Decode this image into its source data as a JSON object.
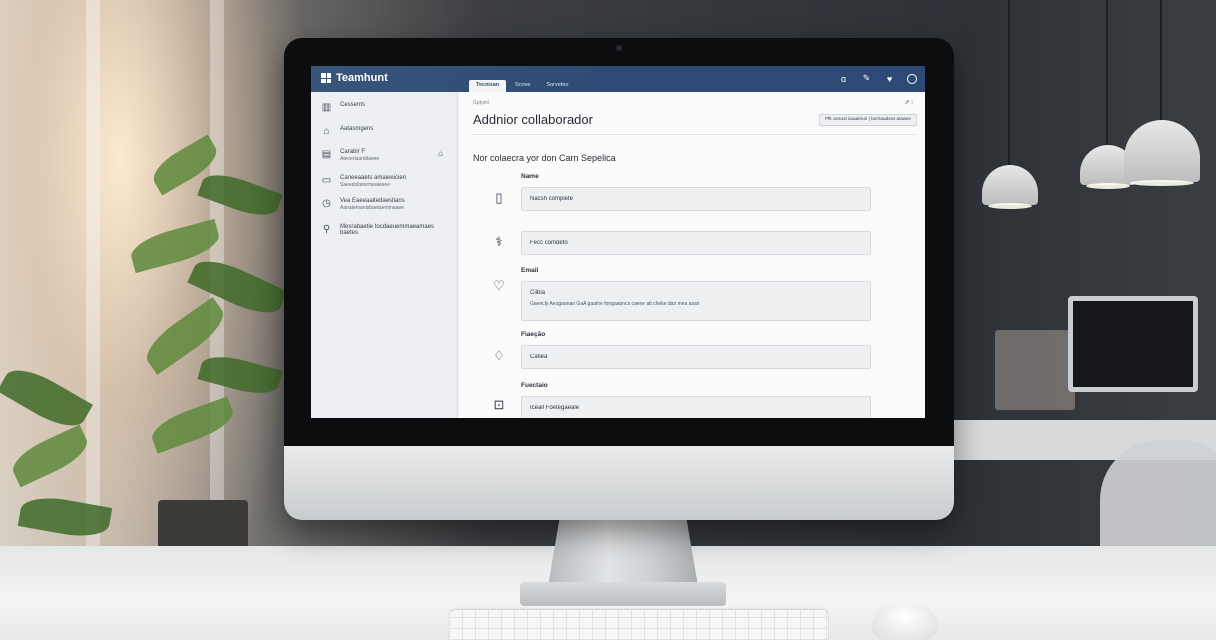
{
  "app": {
    "title": "Teamhunt",
    "tabs": [
      {
        "label": "Tecnizan",
        "active": true
      },
      {
        "label": "Scrive",
        "active": false
      },
      {
        "label": "Sorveteo",
        "active": false
      }
    ],
    "top_icons": [
      "info-icon",
      "pen-icon",
      "heart-icon",
      "circle-icon"
    ]
  },
  "sidebar": {
    "items": [
      {
        "icon": "chart-bar-icon",
        "label": "Cessents",
        "sub": ""
      },
      {
        "icon": "building-icon",
        "label": "Aatasmgens",
        "sub": ""
      },
      {
        "icon": "calendar-icon",
        "label": "Carabir F",
        "sub": "Ateceriaandtaeee",
        "extra": "⌂"
      },
      {
        "icon": "monitor-icon",
        "label": "Caneeaaets amaieeicien",
        "sub": "Saeedoltanemeaieeee"
      },
      {
        "icon": "clock-icon",
        "label": "Vea Eaeeaaitedaestians",
        "sub": "Aanatemanisbaetaemmaaee"
      },
      {
        "icon": "user-search-icon",
        "label": "Mesrabaetie tocdaeuemmaeamaes baetes",
        "sub": ""
      }
    ]
  },
  "main": {
    "breadcrumb": "Gptyeti",
    "title": "Addnior collaborador",
    "header_actions": "⇗ ⁝",
    "header_button": "Pllt acsust iiaaaieuri | lacrtaadeat ataaee",
    "section_title": "Nor colaecra yor don Carn Sepelica",
    "fields": [
      {
        "label": "Name",
        "icon": "id-card-icon",
        "value": "Nacsh complete",
        "placeholder": "Nacsh complete"
      },
      {
        "label": "",
        "icon": "stethoscope-icon",
        "value": "",
        "placeholder": "Fecc comdeto"
      },
      {
        "label": "Email",
        "icon": "heart-hand-icon",
        "line1": "Ciibia",
        "line2": "Gaeecly Aeugaanan GaA gaatne fongaaoncs caene ait cheke dari mea asan"
      },
      {
        "label": "Fiaeção",
        "icon": "hand-heart-icon",
        "value": "",
        "placeholder": "Catiéa"
      },
      {
        "label": "Fuectaio",
        "icon": "easel-icon",
        "value": "",
        "placeholder": "Iceall Foetegaeale"
      }
    ]
  }
}
